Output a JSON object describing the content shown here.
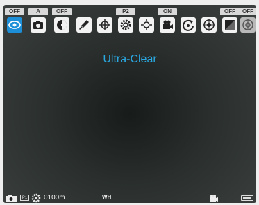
{
  "menu": {
    "items": [
      {
        "label": "OFF",
        "icon": "eye-icon",
        "selected": true
      },
      {
        "label": "A",
        "icon": "camera-icon"
      },
      {
        "label": "OFF",
        "icon": "contrast-icon"
      },
      {
        "label": "",
        "icon": "brush-icon"
      },
      {
        "label": "",
        "icon": "crosshair-icon"
      },
      {
        "label": "P2",
        "icon": "gear-icon"
      },
      {
        "label": "",
        "icon": "focus-icon"
      },
      {
        "label": "ON",
        "icon": "video-camera-icon"
      },
      {
        "label": "",
        "icon": "rotate-icon"
      },
      {
        "label": "",
        "icon": "target-icon"
      },
      {
        "label": "OFF",
        "icon": "square-icon"
      },
      {
        "label": "OFF",
        "icon": "disc-icon",
        "dimmed": true
      }
    ]
  },
  "mode_text": "Ultra-Clear",
  "status": {
    "p_badge": "P1",
    "distance": "0100m",
    "white_balance": "WH"
  },
  "colors": {
    "accent": "#1c8fd8",
    "mode_text": "#2aa8e2"
  }
}
